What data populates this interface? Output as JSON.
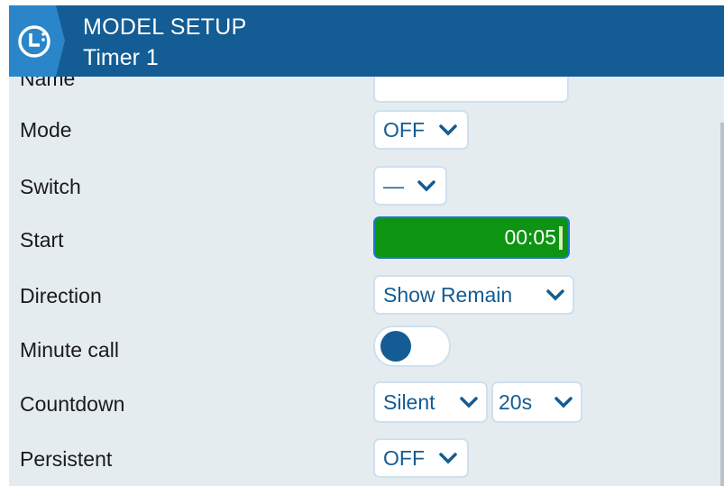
{
  "header": {
    "title": "MODEL SETUP",
    "subtitle": "Timer 1",
    "icon": "timer-clock-icon",
    "color": "#135c94"
  },
  "rows": {
    "name": {
      "label": "Name",
      "value": ""
    },
    "mode": {
      "label": "Mode",
      "value": "OFF"
    },
    "switch": {
      "label": "Switch",
      "value": "—"
    },
    "start": {
      "label": "Start",
      "value": "00:05"
    },
    "direction": {
      "label": "Direction",
      "value": "Show Remain"
    },
    "minute_call": {
      "label": "Minute call",
      "value": false
    },
    "countdown": {
      "label": "Countdown",
      "value": "Silent",
      "time_value": "20s"
    },
    "persistent": {
      "label": "Persistent",
      "value": "OFF"
    }
  },
  "colors": {
    "accent": "#135c94",
    "edit_active": "#0d9413",
    "background": "#e5ecf0"
  }
}
